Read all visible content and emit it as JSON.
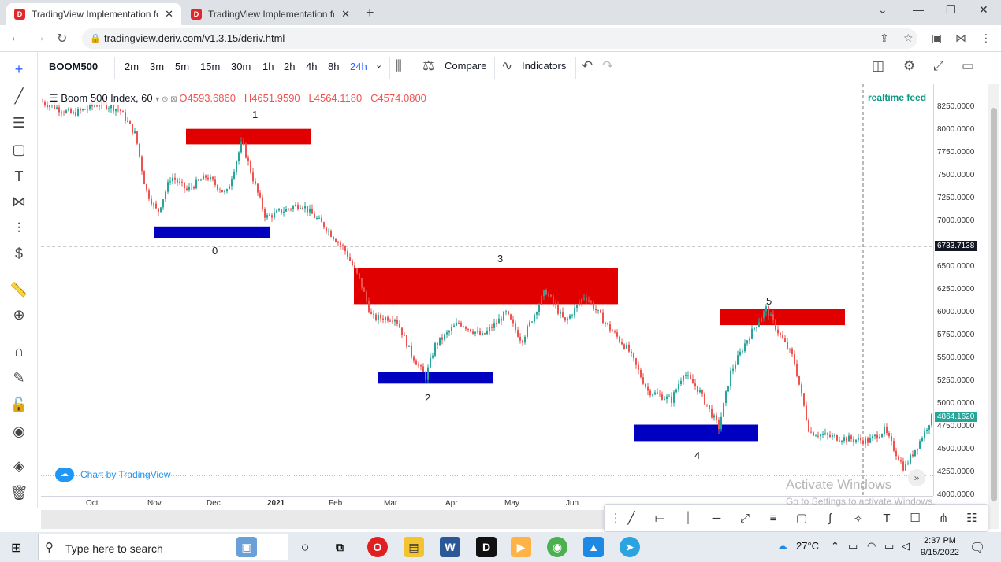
{
  "browser": {
    "tabs": [
      {
        "title": "TradingView Implementation for",
        "close": "✕",
        "active": true
      },
      {
        "title": "TradingView Implementation for",
        "close": "✕",
        "active": false
      }
    ],
    "new_tab": "+",
    "address": "tradingview.deriv.com/v1.3.15/deriv.html"
  },
  "toolbar": {
    "symbol": "BOOM500",
    "intervals": [
      "2m",
      "3m",
      "5m",
      "15m",
      "30m",
      "1h",
      "2h",
      "4h",
      "8h",
      "24h"
    ],
    "selected_interval": "24h",
    "compare_label": "Compare",
    "indicators_label": "Indicators"
  },
  "legend": {
    "title": "Boom 500 Index, 60",
    "open": "O4593.6860",
    "high": "H4651.9590",
    "low": "L4564.1180",
    "close": "C4574.0800"
  },
  "realtime_feed": "realtime feed",
  "price_axis": {
    "ticks": [
      "8250.0000",
      "8000.0000",
      "7750.0000",
      "7500.0000",
      "7250.0000",
      "7000.0000",
      "6500.0000",
      "6250.0000",
      "6000.0000",
      "5750.0000",
      "5500.0000",
      "5250.0000",
      "5000.0000",
      "4750.0000",
      "4500.0000",
      "4250.0000",
      "4000.0000"
    ],
    "crosshair_price": "6733.7138",
    "last_price": "4864.1620",
    "last_price_color": "#26a69a"
  },
  "time_axis": {
    "ticks": [
      "Oct",
      "Nov",
      "Dec",
      "2021",
      "Feb",
      "Mar",
      "Apr",
      "May",
      "Jun"
    ]
  },
  "chart_data": {
    "type": "candlestick",
    "symbol": "Boom 500 Index",
    "ylim": [
      4000,
      8400
    ],
    "up_color": "#26a69a",
    "down_color": "#ef5350",
    "zones": [
      {
        "label": "1",
        "kind": "supply",
        "color": "#e00000",
        "from": "Nov",
        "to": "Dec",
        "low": 7850,
        "high": 8020
      },
      {
        "label": "0",
        "kind": "demand",
        "color": "#0000c0",
        "from": "Nov",
        "to": "Dec",
        "low": 6820,
        "high": 6950
      },
      {
        "label": "3",
        "kind": "supply",
        "color": "#e00000",
        "from": "Feb",
        "to": "May",
        "low": 6100,
        "high": 6500
      },
      {
        "label": "2",
        "kind": "demand",
        "color": "#0000c0",
        "from": "Mar",
        "to": "Apr",
        "low": 5230,
        "high": 5360
      },
      {
        "label": "5",
        "kind": "supply",
        "color": "#e00000",
        "from": "Jun",
        "to": "Jul",
        "low": 5870,
        "high": 6050
      },
      {
        "label": "4",
        "kind": "demand",
        "color": "#0000c0",
        "from": "Jun",
        "to": "Jul",
        "low": 4600,
        "high": 4780
      }
    ]
  },
  "watermark": "Chart by TradingView",
  "activate_windows": {
    "title": "Activate Windows",
    "subtitle": "Go to Settings to activate Windows."
  },
  "taskbar": {
    "search_placeholder": "Type here to search",
    "temperature": "27°C",
    "time": "2:37 PM",
    "date": "9/15/2022"
  }
}
